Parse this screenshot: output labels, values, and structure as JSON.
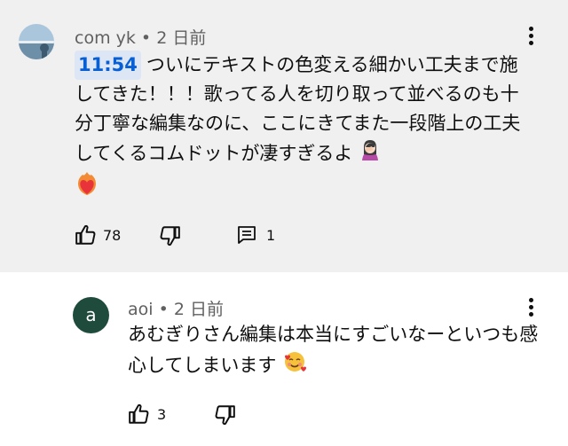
{
  "comments": [
    {
      "author": "com yk",
      "separator": "•",
      "time": "2 日前",
      "timestamp_link": "11:54",
      "text": "ついにテキストの色変える細かい工夫まで施してきた！！！歌ってる人を切り取って並べるのも十分丁寧な編集なのに、ここにきてまた一段階上の工夫してくるコムドットが凄すぎるよ",
      "emoji_1": "face-palm-woman-emoji",
      "emoji_2": "heart-on-fire-emoji",
      "likes": "78",
      "replies": "1"
    },
    {
      "author": "aoi",
      "separator": "•",
      "time": "2 日前",
      "avatar_letter": "a",
      "avatar_color": "#1e4b3c",
      "text": "あむぎりさん編集は本当にすごいなーといつも感心してしまいます",
      "emoji": "smiling-face-with-hearts-emoji",
      "likes": "3"
    }
  ],
  "colors": {
    "highlight_bg": "#f0f0f0",
    "timestamp_blue": "#065fd4",
    "text": "#0f0f0f",
    "meta": "#606060"
  }
}
